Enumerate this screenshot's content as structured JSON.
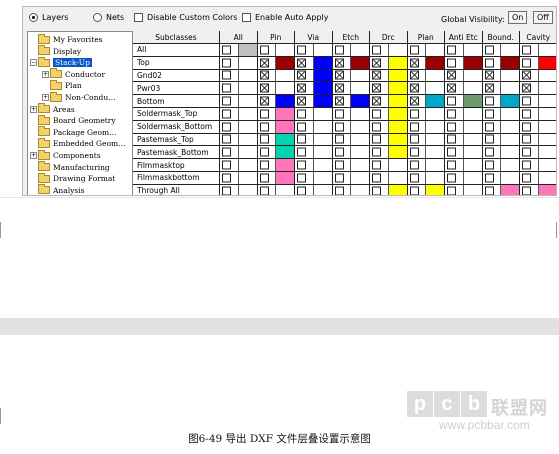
{
  "options": {
    "layers_label": "Layers",
    "nets_label": "Nets",
    "disable_custom_colors": "Disable Custom Colors",
    "enable_auto_apply": "Enable Auto Apply",
    "global_visibility": "Global Visibility:",
    "on_label": "On",
    "off_label": "Off",
    "selected_radio": "Layers"
  },
  "tree": [
    {
      "label": "My Favorites",
      "level": 0,
      "expander": "",
      "selected": false
    },
    {
      "label": "Display",
      "level": 0,
      "expander": "",
      "selected": false
    },
    {
      "label": "Stack-Up",
      "level": 0,
      "expander": "−",
      "selected": true
    },
    {
      "label": "Conductor",
      "level": 1,
      "expander": "+",
      "selected": false
    },
    {
      "label": "Plan",
      "level": 1,
      "expander": "",
      "selected": false
    },
    {
      "label": "Non-Condu…",
      "level": 1,
      "expander": "+",
      "selected": false
    },
    {
      "label": "Areas",
      "level": 0,
      "expander": "+",
      "selected": false
    },
    {
      "label": "Board Geometry",
      "level": 0,
      "expander": "",
      "selected": false
    },
    {
      "label": "Package Geom…",
      "level": 0,
      "expander": "",
      "selected": false
    },
    {
      "label": "Embedded Geom…",
      "level": 0,
      "expander": "",
      "selected": false
    },
    {
      "label": "Components",
      "level": 0,
      "expander": "+",
      "selected": false
    },
    {
      "label": "Manufacturing",
      "level": 0,
      "expander": "",
      "selected": false
    },
    {
      "label": "Drawing Format",
      "level": 0,
      "expander": "",
      "selected": false
    },
    {
      "label": "Analysis",
      "level": 0,
      "expander": "",
      "selected": false
    }
  ],
  "grid": {
    "columns": [
      "Subclasses",
      "All",
      "Pin",
      "Via",
      "Etch",
      "Drc",
      "Plan",
      "Anti Etc",
      "Bound.",
      "Cavity"
    ],
    "rows": [
      {
        "name": "All",
        "cells": [
          [
            false,
            "#c0c0c0"
          ],
          [
            false,
            ""
          ],
          [
            false,
            ""
          ],
          [
            false,
            ""
          ],
          [
            false,
            ""
          ],
          [
            false,
            ""
          ],
          [
            false,
            ""
          ],
          [
            false,
            ""
          ],
          [
            false,
            ""
          ]
        ]
      },
      {
        "name": "Top",
        "cells": [
          [
            false,
            ""
          ],
          [
            true,
            "#990000"
          ],
          [
            true,
            "#0000ff"
          ],
          [
            true,
            "#990000"
          ],
          [
            true,
            "#ffff00"
          ],
          [
            true,
            "#990000"
          ],
          [
            false,
            "#990000"
          ],
          [
            false,
            "#990000"
          ],
          [
            false,
            "#ff0000"
          ]
        ]
      },
      {
        "name": "Gnd02",
        "cells": [
          [
            false,
            ""
          ],
          [
            true,
            ""
          ],
          [
            true,
            "#0000ff"
          ],
          [
            true,
            ""
          ],
          [
            true,
            "#ffff00"
          ],
          [
            true,
            ""
          ],
          [
            true,
            ""
          ],
          [
            true,
            ""
          ],
          [
            true,
            ""
          ]
        ]
      },
      {
        "name": "Pwr03",
        "cells": [
          [
            false,
            ""
          ],
          [
            true,
            ""
          ],
          [
            true,
            "#0000ff"
          ],
          [
            true,
            ""
          ],
          [
            true,
            "#ffff00"
          ],
          [
            true,
            ""
          ],
          [
            true,
            ""
          ],
          [
            true,
            ""
          ],
          [
            true,
            ""
          ]
        ]
      },
      {
        "name": "Bottom",
        "cells": [
          [
            false,
            ""
          ],
          [
            true,
            "#0000ff"
          ],
          [
            true,
            "#0000ff"
          ],
          [
            true,
            "#0000ff"
          ],
          [
            true,
            "#ffff00"
          ],
          [
            true,
            "#00a8c8"
          ],
          [
            false,
            "#6e9a6e"
          ],
          [
            false,
            "#00a8c8"
          ],
          [
            false,
            ""
          ]
        ]
      },
      {
        "name": "Soldermask_Top",
        "cells": [
          [
            false,
            ""
          ],
          [
            false,
            "#ff77bb"
          ],
          [
            false,
            ""
          ],
          [
            false,
            ""
          ],
          [
            false,
            "#ffff00"
          ],
          [
            false,
            ""
          ],
          [
            false,
            ""
          ],
          [
            false,
            ""
          ],
          [
            false,
            ""
          ]
        ]
      },
      {
        "name": "Soldermask_Bottom",
        "cells": [
          [
            false,
            ""
          ],
          [
            false,
            "#ff77bb"
          ],
          [
            false,
            ""
          ],
          [
            false,
            ""
          ],
          [
            false,
            "#ffff00"
          ],
          [
            false,
            ""
          ],
          [
            false,
            ""
          ],
          [
            false,
            ""
          ],
          [
            false,
            ""
          ]
        ]
      },
      {
        "name": "Pastemask_Top",
        "cells": [
          [
            false,
            ""
          ],
          [
            false,
            "#00d4aa"
          ],
          [
            false,
            ""
          ],
          [
            false,
            ""
          ],
          [
            false,
            "#ffff00"
          ],
          [
            false,
            ""
          ],
          [
            false,
            ""
          ],
          [
            false,
            ""
          ],
          [
            false,
            ""
          ]
        ]
      },
      {
        "name": "Pastemask_Bottom",
        "cells": [
          [
            false,
            ""
          ],
          [
            false,
            "#00d4aa"
          ],
          [
            false,
            ""
          ],
          [
            false,
            ""
          ],
          [
            false,
            "#ffff00"
          ],
          [
            false,
            ""
          ],
          [
            false,
            ""
          ],
          [
            false,
            ""
          ],
          [
            false,
            ""
          ]
        ]
      },
      {
        "name": "Filmmasktop",
        "cells": [
          [
            false,
            ""
          ],
          [
            false,
            "#ff77bb"
          ],
          [
            false,
            ""
          ],
          [
            false,
            ""
          ],
          [
            false,
            ""
          ],
          [
            false,
            ""
          ],
          [
            false,
            ""
          ],
          [
            false,
            ""
          ],
          [
            false,
            ""
          ]
        ]
      },
      {
        "name": "Filmmaskbottom",
        "cells": [
          [
            false,
            ""
          ],
          [
            false,
            "#ff77bb"
          ],
          [
            false,
            ""
          ],
          [
            false,
            ""
          ],
          [
            false,
            ""
          ],
          [
            false,
            ""
          ],
          [
            false,
            ""
          ],
          [
            false,
            ""
          ],
          [
            false,
            ""
          ]
        ]
      },
      {
        "name": "Through All",
        "cells": [
          [
            false,
            ""
          ],
          [
            false,
            ""
          ],
          [
            false,
            ""
          ],
          [
            false,
            ""
          ],
          [
            false,
            "#ffff00"
          ],
          [
            false,
            "#ffff00"
          ],
          [
            false,
            ""
          ],
          [
            false,
            "#ff77bb"
          ],
          [
            false,
            "#ff77bb"
          ]
        ]
      }
    ]
  },
  "watermark": {
    "letters": [
      "p",
      "c",
      "b"
    ],
    "cn": "联盟网",
    "url": "www.pcbbar.com"
  },
  "caption": "图6-49   导出 DXF 文件层叠设置示意图"
}
